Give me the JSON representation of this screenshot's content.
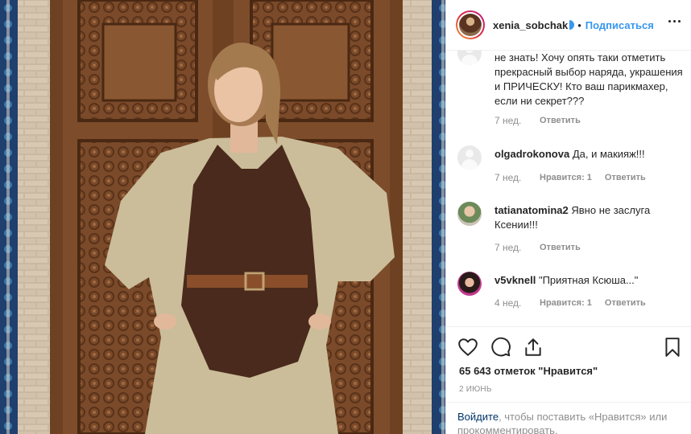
{
  "header": {
    "username": "xenia_sobchak",
    "separator": "•",
    "follow_label": "Подписаться"
  },
  "comments": [
    {
      "user": "",
      "text": "не знать! Хочу опять таки отметить прекрасный выбор наряда, украшения и ПРИЧЕСКУ! Кто ваш парикмахер, если ни секрет???",
      "ago": "7 нед.",
      "likes": "",
      "reply": "Ответить"
    },
    {
      "user": "olgadrokonova",
      "text": "Да, и макияж!!!",
      "ago": "7 нед.",
      "likes": "Нравится: 1",
      "reply": "Ответить"
    },
    {
      "user": "tatianatomina2",
      "text": "Явно не заслуга Ксении!!!",
      "ago": "7 нед.",
      "likes": "",
      "reply": "Ответить"
    },
    {
      "user": "v5vknell",
      "text": "\"Приятная Ксюша...\"",
      "ago": "4 нед.",
      "likes": "Нравится: 1",
      "reply": "Ответить"
    }
  ],
  "post": {
    "likes_text": "65 643 отметок \"Нравится\"",
    "date": "2 ИЮНЬ"
  },
  "login": {
    "link_label": "Войдите",
    "rest_text": ", чтобы поставить «Нравится» или прокомментировать."
  },
  "icons": {
    "like": "heart-icon",
    "comment": "comment-bubble-icon",
    "share": "share-upload-icon",
    "save": "bookmark-icon",
    "more": "more-options-icon"
  },
  "colors": {
    "accent": "#3897f0",
    "login_link": "#003569",
    "muted": "#8e8e8e",
    "text": "#262626"
  }
}
